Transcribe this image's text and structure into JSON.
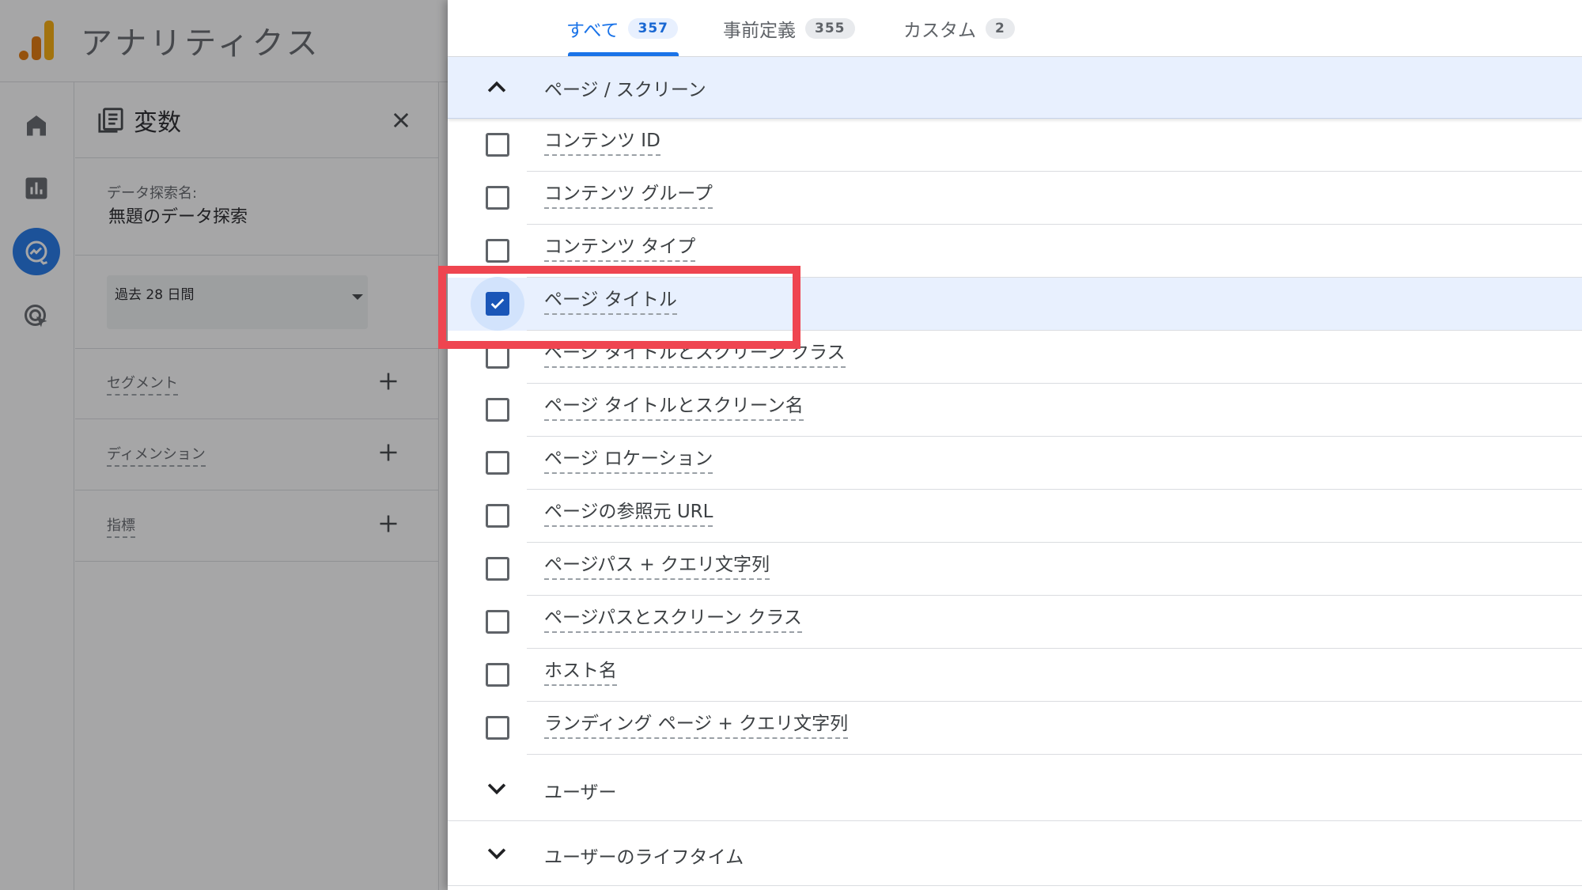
{
  "app": {
    "title": "アナリティクス"
  },
  "nav": {
    "items": [
      {
        "name": "home",
        "icon": "home-icon",
        "active": false
      },
      {
        "name": "reports",
        "icon": "bar-chart-icon",
        "active": false
      },
      {
        "name": "explore",
        "icon": "explore-icon",
        "active": true
      },
      {
        "name": "advertising",
        "icon": "ads-target-icon",
        "active": false
      }
    ]
  },
  "variables_panel": {
    "title": "変数",
    "exploration_name_label": "データ探索名:",
    "exploration_name": "無題のデータ探索",
    "date_range": "過去 28 日間",
    "sections": [
      {
        "label": "セグメント"
      },
      {
        "label": "ディメンション"
      },
      {
        "label": "指標"
      }
    ]
  },
  "picker": {
    "tabs": [
      {
        "label": "すべて",
        "count": "357",
        "active": true
      },
      {
        "label": "事前定義",
        "count": "355",
        "active": false
      },
      {
        "label": "カスタム",
        "count": "2",
        "active": false
      }
    ],
    "expanded_group": "ページ / スクリーン",
    "dimensions": [
      {
        "label": "コンテンツ ID",
        "checked": false
      },
      {
        "label": "コンテンツ グループ",
        "checked": false
      },
      {
        "label": "コンテンツ タイプ",
        "checked": false
      },
      {
        "label": "ページ タイトル",
        "checked": true
      },
      {
        "label": "ページ タイトルとスクリーン クラス",
        "checked": false
      },
      {
        "label": "ページ タイトルとスクリーン名",
        "checked": false
      },
      {
        "label": "ページ ロケーション",
        "checked": false
      },
      {
        "label": "ページの参照元 URL",
        "checked": false
      },
      {
        "label": "ページパス + クエリ文字列",
        "checked": false
      },
      {
        "label": "ページパスとスクリーン クラス",
        "checked": false
      },
      {
        "label": "ホスト名",
        "checked": false
      },
      {
        "label": "ランディング ページ + クエリ文字列",
        "checked": false
      }
    ],
    "collapsed_groups": [
      {
        "label": "ユーザー"
      },
      {
        "label": "ユーザーのライフタイム"
      }
    ]
  },
  "colors": {
    "accent": "#1a73e8",
    "selected_row": "#e8f0fe",
    "checkbox_checked": "#1a56b8",
    "highlight": "#ef4550"
  }
}
